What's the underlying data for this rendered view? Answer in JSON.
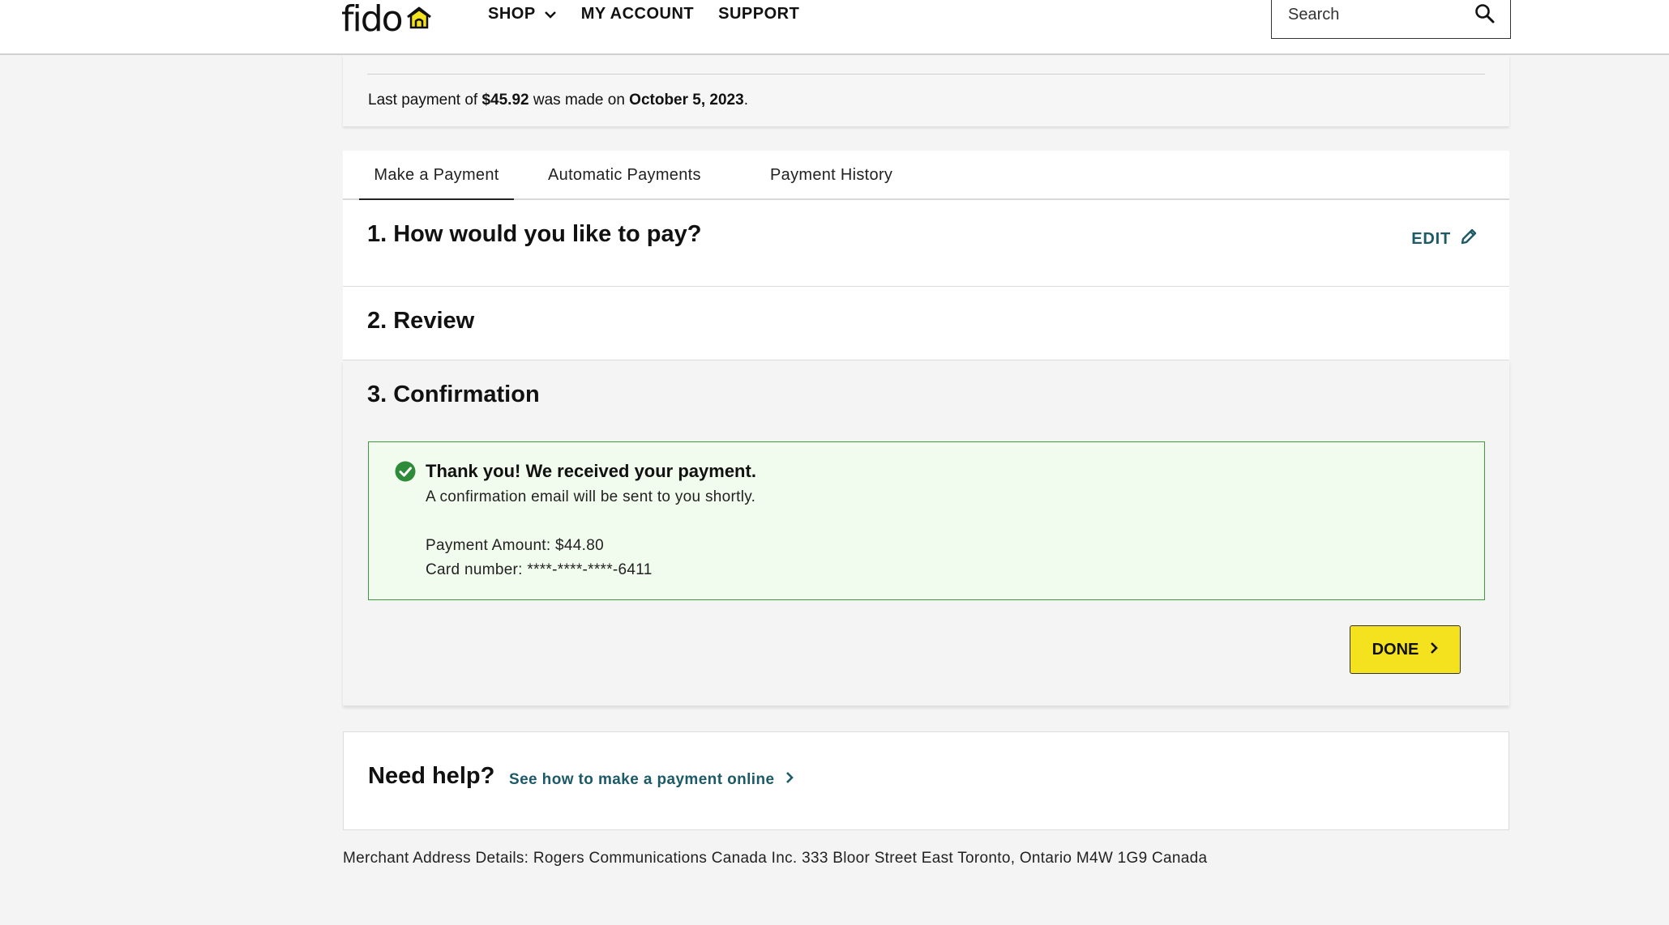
{
  "header": {
    "logo_text": "fido",
    "nav": [
      {
        "label": "SHOP",
        "has_dropdown": true
      },
      {
        "label": "MY ACCOUNT",
        "has_dropdown": false
      },
      {
        "label": "SUPPORT",
        "has_dropdown": false
      }
    ],
    "search": {
      "placeholder": "Search"
    }
  },
  "summary": {
    "text_before": "Last payment of ",
    "amount": "$45.92",
    "text_middle": " was made on ",
    "date": "October 5, 2023",
    "text_after": "."
  },
  "tabs": [
    {
      "label": "Make a Payment",
      "active": true
    },
    {
      "label": "Automatic Payments",
      "active": false
    },
    {
      "label": "Payment History",
      "active": false
    }
  ],
  "steps": {
    "step1": {
      "title": "1. How would you like to pay?",
      "edit_label": "EDIT"
    },
    "step2": {
      "title": "2. Review"
    },
    "step3": {
      "title": "3. Confirmation"
    }
  },
  "confirmation": {
    "title": "Thank you! We received your payment.",
    "subtitle": "A confirmation email will be sent to you shortly.",
    "amount_line": "Payment Amount: $44.80",
    "card_line": "Card number: ****-****-****-6411"
  },
  "done_label": "DONE",
  "help": {
    "title": "Need help?",
    "link_label": "See how to make a payment online"
  },
  "merchant": "Merchant Address Details: Rogers Communications Canada Inc. 333 Bloor Street East Toronto, Ontario M4W 1G9 Canada",
  "colors": {
    "accent_yellow": "#f4e21f",
    "link_teal": "#1c5a66",
    "success_green": "#2e8b3a",
    "success_bg": "#f2fcee"
  },
  "icons": {
    "logo": "house-icon",
    "dropdown": "chevron-down-icon",
    "search": "search-icon",
    "edit": "pencil-icon",
    "success": "check-circle-icon",
    "next": "chevron-right-icon"
  }
}
